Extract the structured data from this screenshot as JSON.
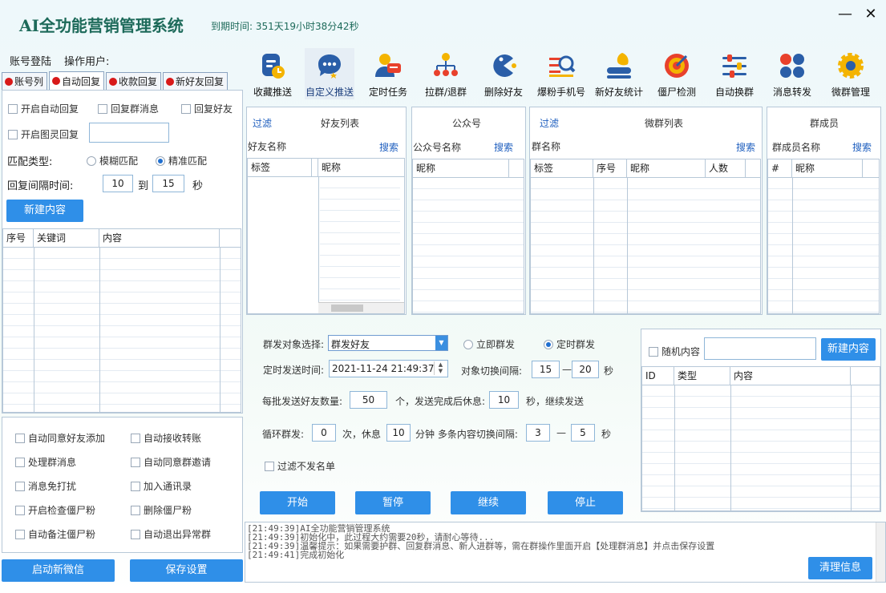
{
  "app": {
    "title": "AI全功能营销管理系统",
    "expire": "到期时间: 351天19小时38分42秒",
    "minimize": "—",
    "close": "✕",
    "account_login": "账号登陆",
    "operator": "操作用户:"
  },
  "left_tabs": [
    "账号列",
    "自动回复",
    "收款回复",
    "新好友回复"
  ],
  "auto_reply": {
    "enable_auto_reply": "开启自动回复",
    "reply_group_msg": "回复群消息",
    "reply_friend": "回复好友",
    "enable_image_reply": "开启图灵回复",
    "image_reply_value": "",
    "match_type_label": "匹配类型:",
    "fuzzy": "模糊匹配",
    "exact": "精准匹配",
    "interval_label": "回复间隔时间:",
    "interval_from": "10",
    "to": "到",
    "interval_to": "15",
    "sec": "秒",
    "new_content": "新建内容",
    "columns": [
      "序号",
      "关键词",
      "内容"
    ]
  },
  "options": [
    [
      "自动同意好友添加",
      "自动接收转账"
    ],
    [
      "处理群消息",
      "自动同意群邀请"
    ],
    [
      "消息免打扰",
      "加入通讯录"
    ],
    [
      "开启检查僵尸粉",
      "删除僵尸粉"
    ],
    [
      "自动备注僵尸粉",
      "自动退出异常群"
    ]
  ],
  "bottom_buttons": {
    "start_wechat": "启动新微信",
    "save_settings": "保存设置"
  },
  "toolbar": [
    {
      "label": "收藏推送",
      "icon": "clipboard-clock-icon"
    },
    {
      "label": "自定义推送",
      "icon": "chat-bubble-stars-icon"
    },
    {
      "label": "定时任务",
      "icon": "user-message-icon"
    },
    {
      "label": "拉群/退群",
      "icon": "group-tree-icon"
    },
    {
      "label": "删除好友",
      "icon": "pacman-icon"
    },
    {
      "label": "爆粉手机号",
      "icon": "search-list-icon"
    },
    {
      "label": "新好友统计",
      "icon": "user-stats-icon"
    },
    {
      "label": "僵尸检测",
      "icon": "target-icon"
    },
    {
      "label": "自动换群",
      "icon": "sliders-icon"
    },
    {
      "label": "消息转发",
      "icon": "four-dots-icon"
    },
    {
      "label": "微群管理",
      "icon": "gear-icon"
    }
  ],
  "friends_panel": {
    "filter": "过滤",
    "title": "好友列表",
    "name_label": "好友名称",
    "search": "搜索",
    "columns": [
      "标签",
      "昵称"
    ]
  },
  "official_panel": {
    "title": "公众号",
    "name_label": "公众号名称",
    "search": "搜索",
    "columns": [
      "昵称"
    ]
  },
  "groups_panel": {
    "filter": "过滤",
    "title": "微群列表",
    "name_label": "群名称",
    "search": "搜索",
    "columns": [
      "标签",
      "序号",
      "昵称",
      "人数"
    ]
  },
  "members_panel": {
    "title": "群成员",
    "name_label": "群成员名称",
    "search": "搜索",
    "columns": [
      "#",
      "昵称"
    ]
  },
  "broadcast": {
    "target_label": "群发对象选择:",
    "target_value": "群发好友",
    "immediate": "立即群发",
    "scheduled": "定时群发",
    "send_time_label": "定时发送时间:",
    "send_time_value": "2021-11-24 21:49:37",
    "switch_interval_label": "对象切换间隔:",
    "switch_from": "15",
    "dash": "—",
    "switch_to": "20",
    "sec": "秒",
    "batch_label": "每批发送好友数量:",
    "batch_value": "50",
    "batch_unit": "个，发送完成后休息:",
    "rest_value": "10",
    "rest_unit": "秒，继续发送",
    "loop_label": "循环群发:",
    "loop_value": "0",
    "loop_unit": "次，休息",
    "loop_rest": "10",
    "multi_label": "分钟 多条内容切换间隔:",
    "multi_from": "3",
    "dash2": "—",
    "multi_to": "5",
    "sec2": "秒",
    "filter_unsent": "过滤不发名单",
    "start": "开始",
    "pause": "暂停",
    "resume": "继续",
    "stop": "停止"
  },
  "random_panel": {
    "random_content": "随机内容",
    "new_content": "新建内容",
    "columns": [
      "ID",
      "类型",
      "内容"
    ]
  },
  "log": {
    "lines": [
      "[21:49:39]AI全功能营销管理系统",
      "[21:49:39]初始化中，此过程大约需要20秒，请耐心等待...",
      "[21:49:39]温馨提示：如果需要护群、回复群消息、新人进群等，需在群操作里面开启【处理群消息】并点击保存设置",
      "[21:49:41]完成初始化"
    ],
    "clear": "清理信息"
  }
}
